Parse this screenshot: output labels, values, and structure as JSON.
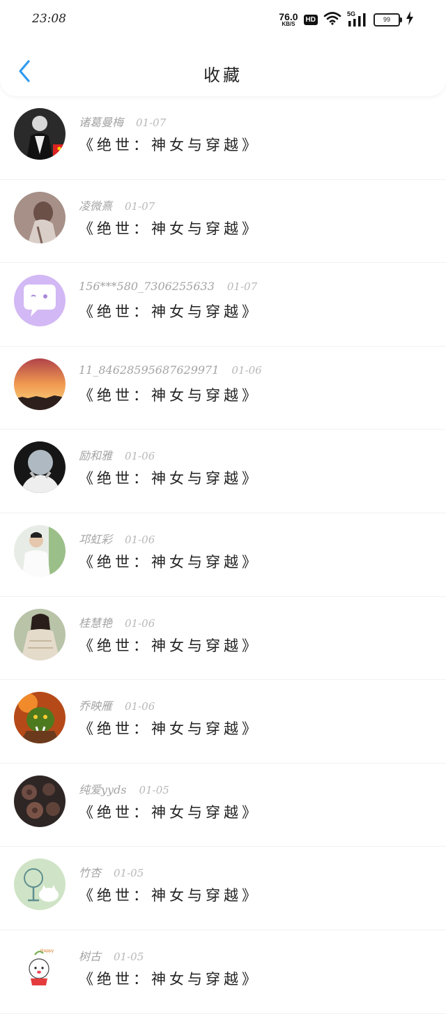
{
  "status_bar": {
    "time": "23:08",
    "net_speed": "76.0",
    "net_unit": "KB/S",
    "hd": "HD",
    "network": "5G",
    "battery": "99"
  },
  "nav": {
    "title": "收藏",
    "back_icon": "chevron-left-icon",
    "accent": "#2f9bf0"
  },
  "favorites": [
    {
      "user": "诸葛曼梅",
      "date": "01-07",
      "title": "《绝世：神女与穿越》",
      "avatar": "bw-photo"
    },
    {
      "user": "凌微熹",
      "date": "01-07",
      "title": "《绝世：神女与穿越》",
      "avatar": "sketch"
    },
    {
      "user": "156***580_7306255633",
      "date": "01-07",
      "title": "《绝世：神女与穿越》",
      "avatar": "chat-bubble"
    },
    {
      "user": "11_84628595687629971",
      "date": "01-06",
      "title": "《绝世：神女与穿越》",
      "avatar": "sunset"
    },
    {
      "user": "励和雅",
      "date": "01-06",
      "title": "《绝世：神女与穿越》",
      "avatar": "grey-hair"
    },
    {
      "user": "邛虹彩",
      "date": "01-06",
      "title": "《绝世：神女与穿越》",
      "avatar": "man-white-shirt"
    },
    {
      "user": "桂慧艳",
      "date": "01-06",
      "title": "《绝世：神女与穿越》",
      "avatar": "girl-sweater"
    },
    {
      "user": "乔映雁",
      "date": "01-06",
      "title": "《绝世：神女与穿越》",
      "avatar": "orc"
    },
    {
      "user": "纯爱yyds",
      "date": "01-05",
      "title": "《绝世：神女与穿越》",
      "avatar": "roses"
    },
    {
      "user": "竹杏",
      "date": "01-05",
      "title": "《绝世：神女与穿越》",
      "avatar": "cat-fan"
    },
    {
      "user": "树古",
      "date": "01-05",
      "title": "《绝世：神女与穿越》",
      "avatar": "sticker-happy"
    }
  ]
}
